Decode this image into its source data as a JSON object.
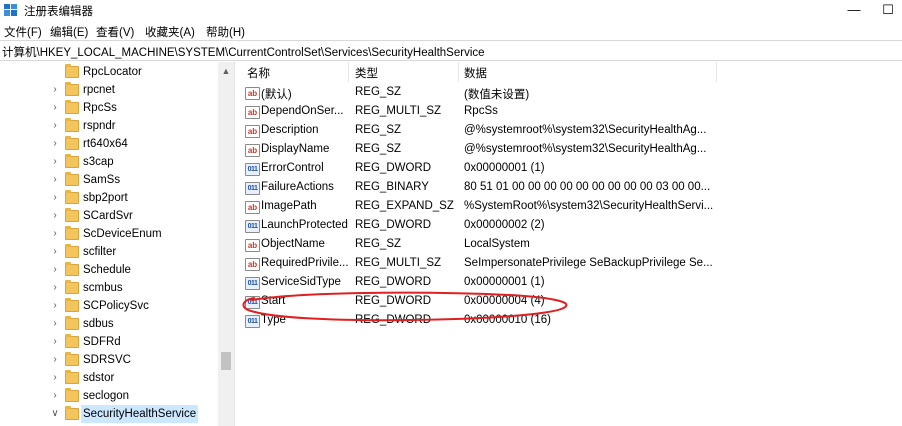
{
  "window": {
    "title": "注册表编辑器",
    "minimize_glyph": "—",
    "maximize_glyph": "☐"
  },
  "menu": [
    "文件(F)",
    "编辑(E)",
    "查看(V)",
    "收藏夹(A)",
    "帮助(H)"
  ],
  "address": "计算机\\HKEY_LOCAL_MACHINE\\SYSTEM\\CurrentControlSet\\Services\\SecurityHealthService",
  "tree": {
    "items": [
      {
        "label": "RpcLocator",
        "expanded": false,
        "selected": false
      },
      {
        "label": "rpcnet",
        "expanded": false,
        "selected": false
      },
      {
        "label": "RpcSs",
        "expanded": false,
        "selected": false
      },
      {
        "label": "rspndr",
        "expanded": false,
        "selected": false
      },
      {
        "label": "rt640x64",
        "expanded": false,
        "selected": false
      },
      {
        "label": "s3cap",
        "expanded": false,
        "selected": false
      },
      {
        "label": "SamSs",
        "expanded": false,
        "selected": false
      },
      {
        "label": "sbp2port",
        "expanded": false,
        "selected": false
      },
      {
        "label": "SCardSvr",
        "expanded": false,
        "selected": false
      },
      {
        "label": "ScDeviceEnum",
        "expanded": false,
        "selected": false
      },
      {
        "label": "scfilter",
        "expanded": false,
        "selected": false
      },
      {
        "label": "Schedule",
        "expanded": false,
        "selected": false
      },
      {
        "label": "scmbus",
        "expanded": false,
        "selected": false
      },
      {
        "label": "SCPolicySvc",
        "expanded": false,
        "selected": false
      },
      {
        "label": "sdbus",
        "expanded": false,
        "selected": false
      },
      {
        "label": "SDFRd",
        "expanded": false,
        "selected": false
      },
      {
        "label": "SDRSVC",
        "expanded": false,
        "selected": false
      },
      {
        "label": "sdstor",
        "expanded": false,
        "selected": false
      },
      {
        "label": "seclogon",
        "expanded": false,
        "selected": false
      },
      {
        "label": "SecurityHealthService",
        "expanded": true,
        "selected": true
      }
    ],
    "first_item_has_chevron": false
  },
  "list": {
    "columns": [
      "名称",
      "类型",
      "数据"
    ],
    "rows": [
      {
        "icon": "string-value-icon",
        "name": "(默认)",
        "type": "REG_SZ",
        "data": "(数值未设置)"
      },
      {
        "icon": "string-value-icon",
        "name": "DependOnSer...",
        "type": "REG_MULTI_SZ",
        "data": "RpcSs"
      },
      {
        "icon": "string-value-icon",
        "name": "Description",
        "type": "REG_SZ",
        "data": "@%systemroot%\\system32\\SecurityHealthAg..."
      },
      {
        "icon": "string-value-icon",
        "name": "DisplayName",
        "type": "REG_SZ",
        "data": "@%systemroot%\\system32\\SecurityHealthAg..."
      },
      {
        "icon": "binary-value-icon",
        "name": "ErrorControl",
        "type": "REG_DWORD",
        "data": "0x00000001 (1)"
      },
      {
        "icon": "binary-value-icon",
        "name": "FailureActions",
        "type": "REG_BINARY",
        "data": "80 51 01 00 00 00 00 00 00 00 00 00 03 00 00..."
      },
      {
        "icon": "string-value-icon",
        "name": "ImagePath",
        "type": "REG_EXPAND_SZ",
        "data": "%SystemRoot%\\system32\\SecurityHealthServi..."
      },
      {
        "icon": "binary-value-icon",
        "name": "LaunchProtected",
        "type": "REG_DWORD",
        "data": "0x00000002 (2)"
      },
      {
        "icon": "string-value-icon",
        "name": "ObjectName",
        "type": "REG_SZ",
        "data": "LocalSystem"
      },
      {
        "icon": "string-value-icon",
        "name": "RequiredPrivile...",
        "type": "REG_MULTI_SZ",
        "data": "SeImpersonatePrivilege SeBackupPrivilege Se..."
      },
      {
        "icon": "binary-value-icon",
        "name": "ServiceSidType",
        "type": "REG_DWORD",
        "data": "0x00000001 (1)"
      },
      {
        "icon": "binary-value-icon",
        "name": "Start",
        "type": "REG_DWORD",
        "data": "0x00000004 (4)"
      },
      {
        "icon": "binary-value-icon",
        "name": "Type",
        "type": "REG_DWORD",
        "data": "0x00000010 (16)"
      }
    ]
  },
  "icons": {
    "string_glyph": "ab",
    "binary_glyph": "011",
    "chevron_collapsed": "›",
    "chevron_expanded": "∨",
    "scroll_up": "▲"
  },
  "colors": {
    "selection": "#cce8ff",
    "annotation_red": "#e02020",
    "folder": "#f4c55c"
  }
}
